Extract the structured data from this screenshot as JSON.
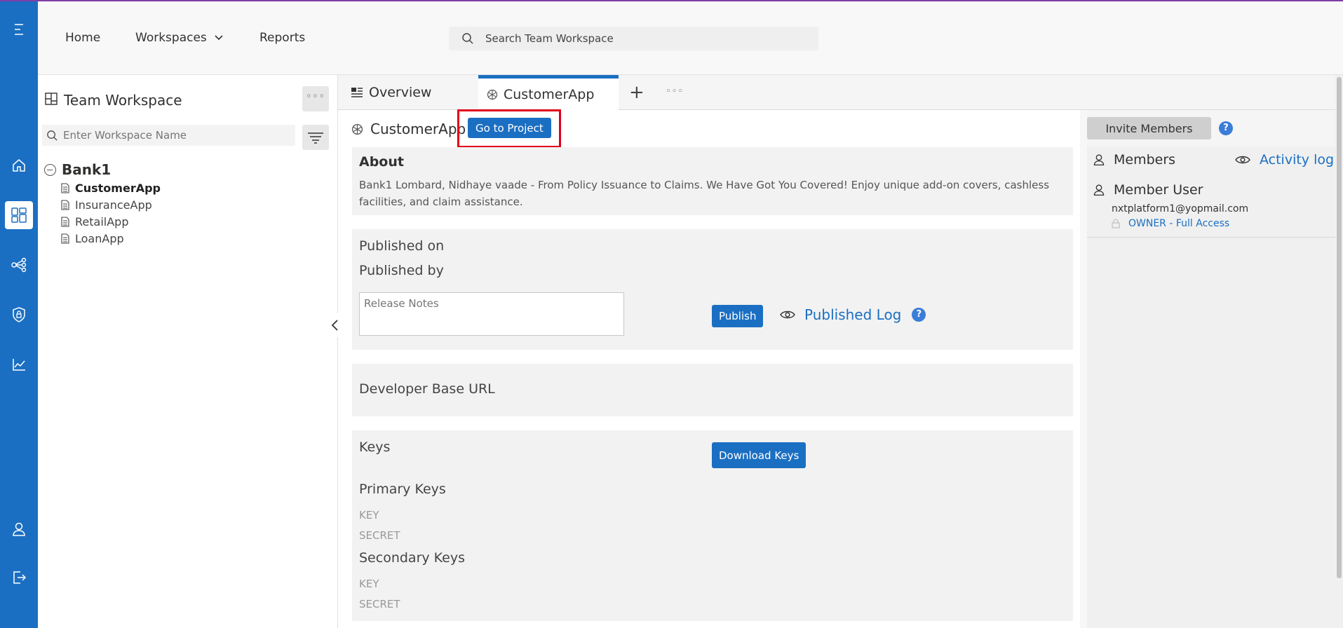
{
  "nav": {
    "home": "Home",
    "workspaces": "Workspaces",
    "reports": "Reports",
    "search_placeholder": "Search Team Workspace"
  },
  "rail": {
    "icons": [
      "menu-icon",
      "home-icon",
      "workspace-icon",
      "share-icon",
      "security-icon",
      "analytics-icon",
      "user-icon",
      "logout-icon"
    ],
    "active": "workspace-icon",
    "color": "#1b6fc2"
  },
  "workspace": {
    "title": "Team Workspace",
    "more": "◦◦◦",
    "search_placeholder": "Enter Workspace Name",
    "root": "Bank1",
    "items": [
      "CustomerApp",
      "InsuranceApp",
      "RetailApp",
      "LoanApp"
    ],
    "selected": "CustomerApp"
  },
  "tabs": {
    "overview": "Overview",
    "customer": "CustomerApp",
    "add": "+",
    "more": "◦◦◦"
  },
  "project": {
    "name": "CustomerApp",
    "go_button": "Go to Project",
    "about_title": "About",
    "about_text": "Bank1 Lombard, Nidhaye vaade - From Policy Issuance to Claims. We Have Got You Covered! Enjoy unique add-on covers, cashless facilities, and claim assistance.",
    "published_on": "Published on",
    "published_by": "Published by",
    "release_notes_placeholder": "Release Notes",
    "publish_button": "Publish",
    "published_log": "Published Log",
    "developer_base_url": "Developer Base URL",
    "keys_title": "Keys",
    "download_keys": "Download Keys",
    "primary_keys": "Primary Keys",
    "secondary_keys": "Secondary Keys",
    "key_label": "KEY",
    "secret_label": "SECRET"
  },
  "members": {
    "invite_button": "Invite Members",
    "title": "Members",
    "activity_log": "Activity log",
    "user_name": "Member User",
    "user_email": "nxtplatform1@yopmail.com",
    "user_role": "OWNER - Full Access"
  },
  "help_glyph": "?"
}
